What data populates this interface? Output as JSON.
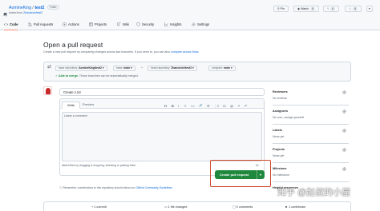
{
  "repo": {
    "owner": "AomineKing",
    "separator": " / ",
    "name": "test2",
    "visibility": "Public",
    "forked_prefix": "forked from ",
    "forked_from": "Zhancircle/test2"
  },
  "header_buttons": {
    "pin": "Pin",
    "watch": "Watch",
    "watch_count": "0",
    "fork_count": "0",
    "star_count": "0"
  },
  "tabs": [
    {
      "label": "Code",
      "icon": "code-icon"
    },
    {
      "label": "Pull requests",
      "icon": "pull-request-icon"
    },
    {
      "label": "Actions",
      "icon": "play-icon"
    },
    {
      "label": "Projects",
      "icon": "table-icon"
    },
    {
      "label": "Wiki",
      "icon": "book-icon"
    },
    {
      "label": "Security",
      "icon": "shield-icon"
    },
    {
      "label": "Insights",
      "icon": "graph-icon"
    },
    {
      "label": "Settings",
      "icon": "gear-icon"
    }
  ],
  "page": {
    "title": "Open a pull request",
    "subtitle_prefix": "Create a new pull request by comparing changes across two branches. If you need to, you can also ",
    "subtitle_link": "compare across forks."
  },
  "compare": {
    "base_repo_label": "base repository: ",
    "base_repo": "AomineKing/test2",
    "base_label": "base: ",
    "base": "main",
    "head_repo_label": "head repository: ",
    "head_repo": "Zhancircle/test2",
    "compare_label": "compare: ",
    "compare_branch": "main",
    "able_to_merge": "Able to merge.",
    "able_to_merge_rest": " These branches can be automatically merged."
  },
  "form": {
    "title_value": "Create 1.txt",
    "write_tab": "Write",
    "preview_tab": "Preview",
    "comment_placeholder": "Leave a comment",
    "attach_hint": "Attach files by dragging & dropping, selecting or pasting them.",
    "toolbar": [
      "H",
      "B",
      "I",
      "≡",
      "<>",
      "🔗",
      "☰",
      "⋮≡",
      "☑",
      "@",
      "↗",
      "↶"
    ],
    "submit_label": "Create pull request",
    "submit_caret": "▾",
    "markdown_badge": "M↓"
  },
  "notice": {
    "prefix": "Remember, contributions to this repository should follow our ",
    "link": "GitHub Community Guidelines."
  },
  "sidebar": [
    {
      "heading": "Reviewers",
      "value": "No reviews"
    },
    {
      "heading": "Assignees",
      "value": "No one—assign yourself"
    },
    {
      "heading": "Labels",
      "value": "None yet"
    },
    {
      "heading": "Projects",
      "value": "None yet"
    },
    {
      "heading": "Milestone",
      "value": "No milestone"
    },
    {
      "heading": "Helpful resources",
      "value": ""
    }
  ],
  "footer": {
    "commits": "1 commit",
    "files": "1 file changed",
    "comments": "0 comments",
    "contributors": "1 contributor"
  },
  "watermark": "知乎 @赵叔的小屋",
  "colors": {
    "accent": "#1f883d",
    "highlight": "#d0492a",
    "link": "#0969da",
    "tab_underline": "#fd8c73"
  }
}
